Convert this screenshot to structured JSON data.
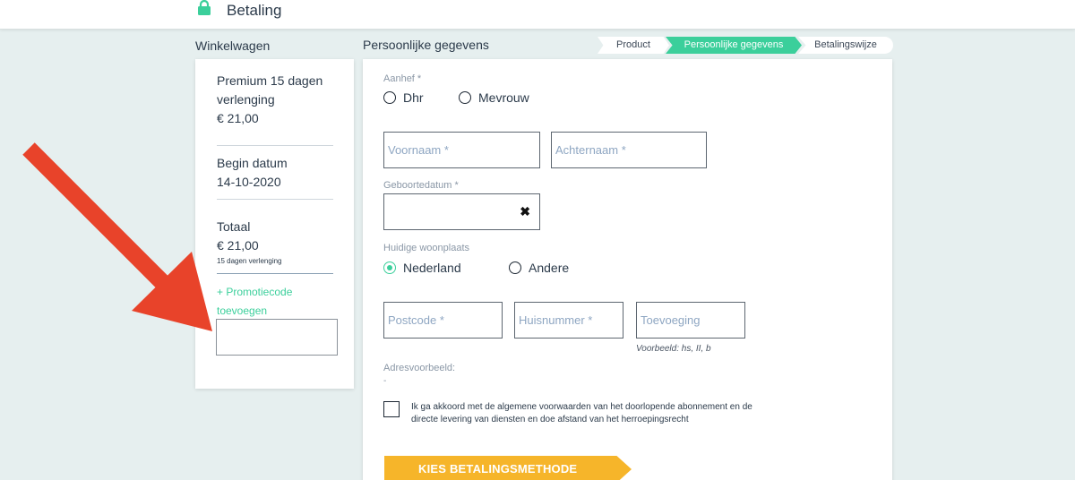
{
  "header": {
    "title": "Betaling",
    "lock_icon": "lock-icon",
    "accent": "#3bcf9b"
  },
  "cart": {
    "heading": "Winkelwagen",
    "product_line1": "Premium 15 dagen",
    "product_line2": "verlenging",
    "product_price": "€ 21,00",
    "start_label": "Begin datum",
    "start_value": "14-10-2020",
    "total_label": "Totaal",
    "total_value": "€ 21,00",
    "total_note": "15 dagen verlenging",
    "promo_line1": "+ Promotiecode",
    "promo_line2": "toevoegen",
    "promo_value": ""
  },
  "form": {
    "heading": "Persoonlijke gegevens",
    "steps": [
      "Product",
      "Persoonlijke gegevens",
      "Betalingswijze"
    ],
    "active_step": "Persoonlijke gegevens",
    "salutation_label": "Aanhef *",
    "salutation_options": [
      "Dhr",
      "Mevrouw"
    ],
    "first_name_placeholder": "Voornaam *",
    "last_name_placeholder": "Achternaam *",
    "birthdate_label": "Geboortedatum *",
    "birthdate_value": "",
    "clear_icon": "close-icon",
    "residence_label": "Huidige woonplaats",
    "residence_options": [
      "Nederland",
      "Andere"
    ],
    "residence_selected": "Nederland",
    "postcode_placeholder": "Postcode *",
    "house_number_placeholder": "Huisnummer *",
    "addition_placeholder": "Toevoeging",
    "addition_hint": "Voorbeeld: hs, II, b",
    "address_example_label": "Adresvoorbeeld:",
    "address_example_value": "-",
    "terms_line1": "Ik ga akkoord met de algemene voorwaarden van het doorlopende abonnement en de",
    "terms_line2": "directe levering van diensten en doe afstand van het herroepingsrecht",
    "cta_label": "KIES BETALINGSMETHODE",
    "cta_color": "#f6b52a"
  }
}
